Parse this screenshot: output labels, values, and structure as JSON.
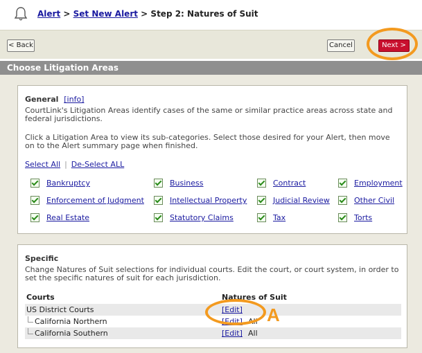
{
  "header": {
    "breadcrumb": [
      {
        "label": "Alert",
        "link": true
      },
      {
        "label": "Set New Alert",
        "link": true
      },
      {
        "label": "Step 2: Natures of Suit",
        "link": false
      }
    ],
    "separator": ">"
  },
  "toolbar": {
    "back_label": "< Back",
    "cancel_label": "Cancel",
    "next_label": "Next >"
  },
  "section_title": "Choose Litigation Areas",
  "general": {
    "title": "General",
    "info_link": "[info]",
    "description": "CourtLink's Litigation Areas identify cases of the same or similar practice areas across state and federal jurisdictions.",
    "instructions": "Click a Litigation Area to view its sub-categories. Select those desired for your Alert, then move on to the Alert summary page when finished.",
    "select_all": "Select All",
    "deselect_all": "De-Select ALL",
    "areas": [
      {
        "label": "Bankruptcy",
        "checked": true
      },
      {
        "label": "Business",
        "checked": true
      },
      {
        "label": "Contract",
        "checked": true
      },
      {
        "label": "Employment",
        "checked": true
      },
      {
        "label": "Enforcement of Judgment",
        "checked": true
      },
      {
        "label": "Intellectual Property",
        "checked": true
      },
      {
        "label": "Judicial Review",
        "checked": true
      },
      {
        "label": "Other Civil",
        "checked": true
      },
      {
        "label": "Real Estate",
        "checked": true
      },
      {
        "label": "Statutory Claims",
        "checked": true
      },
      {
        "label": "Tax",
        "checked": true
      },
      {
        "label": "Torts",
        "checked": true
      }
    ]
  },
  "specific": {
    "title": "Specific",
    "description": "Change Natures of Suit selections for individual courts. Edit the court, or court system, in order to set the specific natures of suit for each jurisdiction.",
    "col_courts": "Courts",
    "col_natures": "Natures of Suit",
    "rows": [
      {
        "court": "US District Courts",
        "edit": "[Edit]",
        "value": ""
      },
      {
        "court": "California Northern",
        "edit": "[Edit]",
        "value": "All"
      },
      {
        "court": "California Southern",
        "edit": "[Edit]",
        "value": "All"
      }
    ]
  },
  "annotation_label": "A",
  "colors": {
    "accent": "#f39a1f",
    "next_button": "#c8102e",
    "link": "#1a1aa0"
  }
}
